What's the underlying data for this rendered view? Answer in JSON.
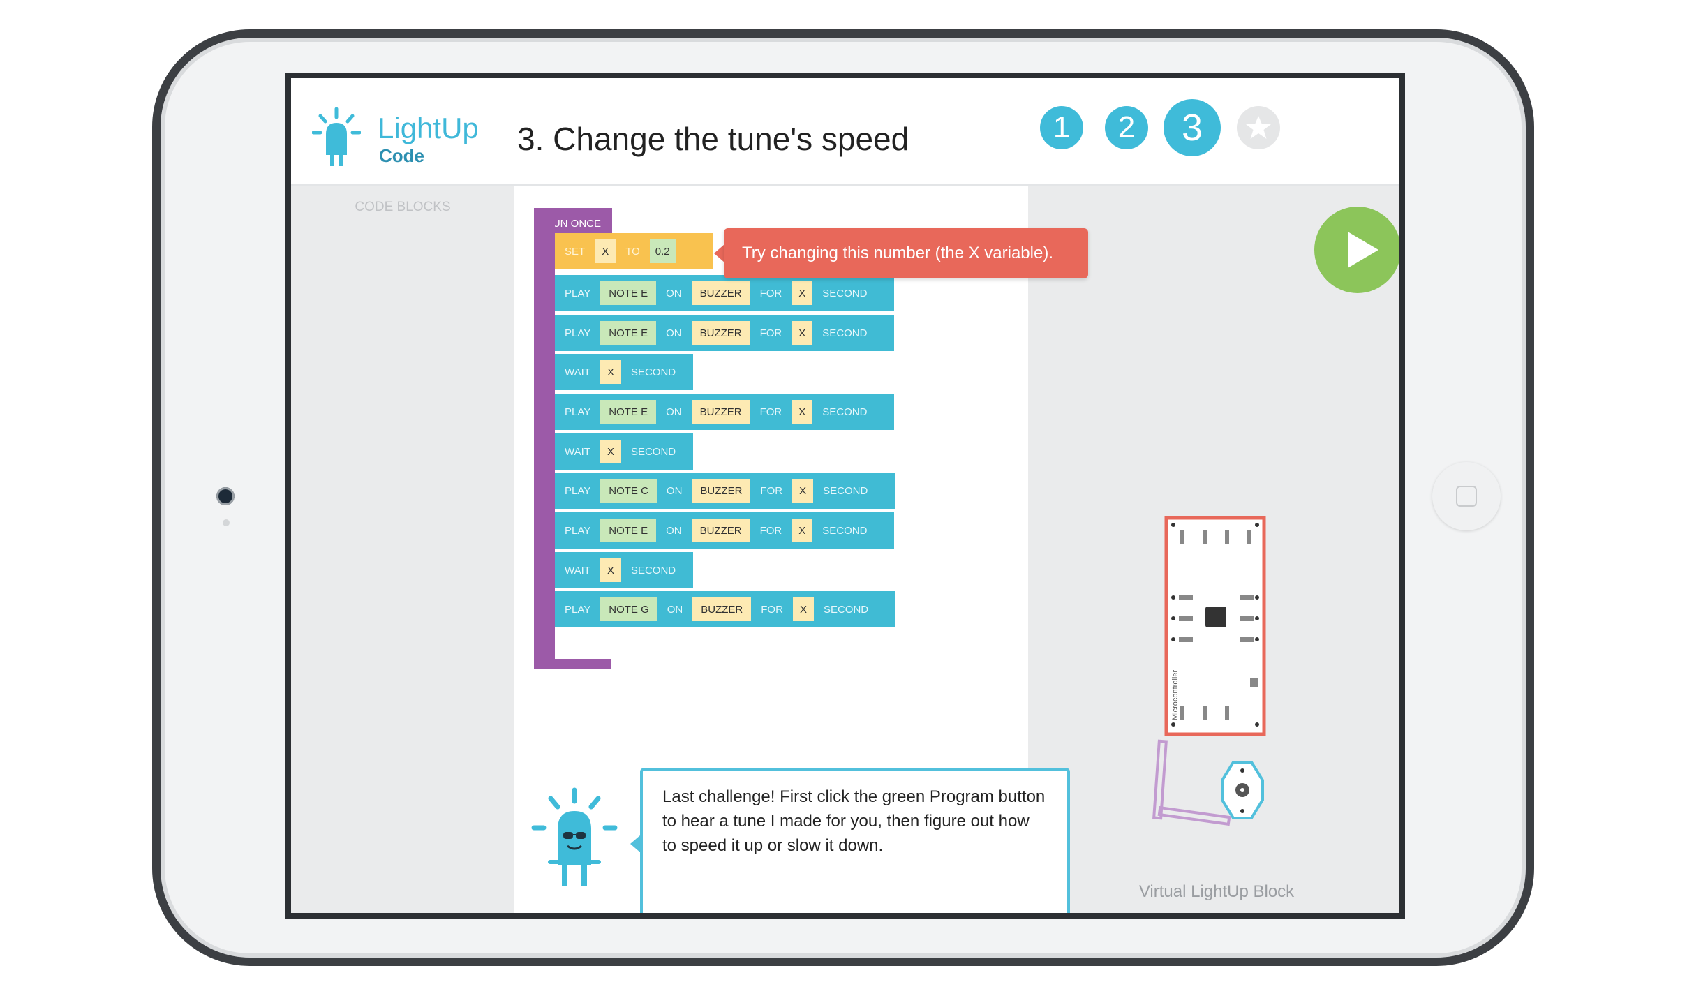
{
  "header": {
    "logo_word": "LightUp",
    "logo_sub": "Code",
    "title": "3. Change the tune's speed",
    "steps": [
      "1",
      "2",
      "3"
    ]
  },
  "left_panel": {
    "label": "CODE BLOCKS"
  },
  "program": {
    "run_label": "RUN ONCE",
    "set_block": {
      "kw_set": "SET",
      "var": "X",
      "kw_to": "TO",
      "value": "0.2"
    },
    "blocks": [
      {
        "kind": "play",
        "kw": "PLAY",
        "note": "NOTE E",
        "on": "ON",
        "device": "BUZZER",
        "for": "FOR",
        "var": "X",
        "unit": "SECOND"
      },
      {
        "kind": "play",
        "kw": "PLAY",
        "note": "NOTE E",
        "on": "ON",
        "device": "BUZZER",
        "for": "FOR",
        "var": "X",
        "unit": "SECOND"
      },
      {
        "kind": "wait",
        "kw": "WAIT",
        "var": "X",
        "unit": "SECOND"
      },
      {
        "kind": "play",
        "kw": "PLAY",
        "note": "NOTE E",
        "on": "ON",
        "device": "BUZZER",
        "for": "FOR",
        "var": "X",
        "unit": "SECOND"
      },
      {
        "kind": "wait",
        "kw": "WAIT",
        "var": "X",
        "unit": "SECOND"
      },
      {
        "kind": "play",
        "kw": "PLAY",
        "note": "NOTE C",
        "on": "ON",
        "device": "BUZZER",
        "for": "FOR",
        "var": "X",
        "unit": "SECOND"
      },
      {
        "kind": "play",
        "kw": "PLAY",
        "note": "NOTE E",
        "on": "ON",
        "device": "BUZZER",
        "for": "FOR",
        "var": "X",
        "unit": "SECOND"
      },
      {
        "kind": "wait",
        "kw": "WAIT",
        "var": "X",
        "unit": "SECOND"
      },
      {
        "kind": "play",
        "kw": "PLAY",
        "note": "NOTE G",
        "on": "ON",
        "device": "BUZZER",
        "for": "FOR",
        "var": "X",
        "unit": "SECOND"
      }
    ]
  },
  "tooltip": {
    "text": "Try changing this number (the X variable)."
  },
  "speech": {
    "text": "Last challenge! First click the green Program button to hear a tune I made for you, then figure out how to speed it up or slow it down."
  },
  "virtual_block": {
    "label": "Virtual LightUp Block",
    "board_label": "Microcontroller"
  },
  "colors": {
    "accent": "#3fbbd9",
    "play_button": "#8cc55a",
    "tooltip": "#e8685a",
    "run_block": "#9c5aa8",
    "set_block": "#f9c24f",
    "play_block": "#40bbd4",
    "board_border": "#e8685a"
  },
  "icons": [
    "lightup-logo-icon",
    "star-icon",
    "play-icon",
    "mascot-icon",
    "microcontroller-board-icon"
  ]
}
